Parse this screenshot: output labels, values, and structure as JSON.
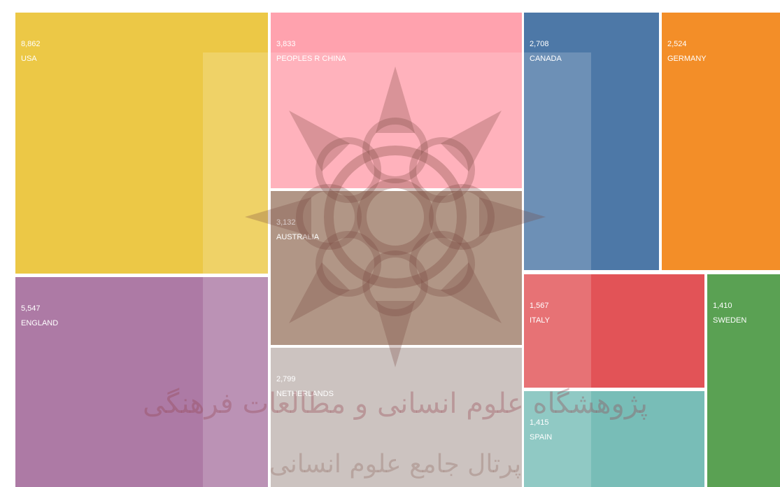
{
  "chart_data": {
    "type": "treemap",
    "items": [
      {
        "label": "USA",
        "value_label": "8,862",
        "value": 8862,
        "color": "#ECC846"
      },
      {
        "label": "ENGLAND",
        "value_label": "5,547",
        "value": 5547,
        "color": "#AD7AA5"
      },
      {
        "label": "PEOPLES R CHINA",
        "value_label": "3,833",
        "value": 3833,
        "color": "#FFA2AE"
      },
      {
        "label": "AUSTRALIA",
        "value_label": "3,132",
        "value": 3132,
        "color": "#A07F6C"
      },
      {
        "label": "NETHERLANDS",
        "value_label": "2,799",
        "value": 2799,
        "color": "#C1B6B2"
      },
      {
        "label": "CANADA",
        "value_label": "2,708",
        "value": 2708,
        "color": "#4D78A7"
      },
      {
        "label": "GERMANY",
        "value_label": "2,524",
        "value": 2524,
        "color": "#F38E28"
      },
      {
        "label": "ITALY",
        "value_label": "1,567",
        "value": 1567,
        "color": "#E25357"
      },
      {
        "label": "SPAIN",
        "value_label": "1,415",
        "value": 1415,
        "color": "#78BDB7"
      },
      {
        "label": "SWEDEN",
        "value_label": "1,410",
        "value": 1410,
        "color": "#5AA153"
      }
    ]
  },
  "watermark": {
    "line1": "پژوهشگاه علوم انسانی و مطالعات فرهنگی",
    "line2": "پرتال جامع علوم انسانی"
  }
}
